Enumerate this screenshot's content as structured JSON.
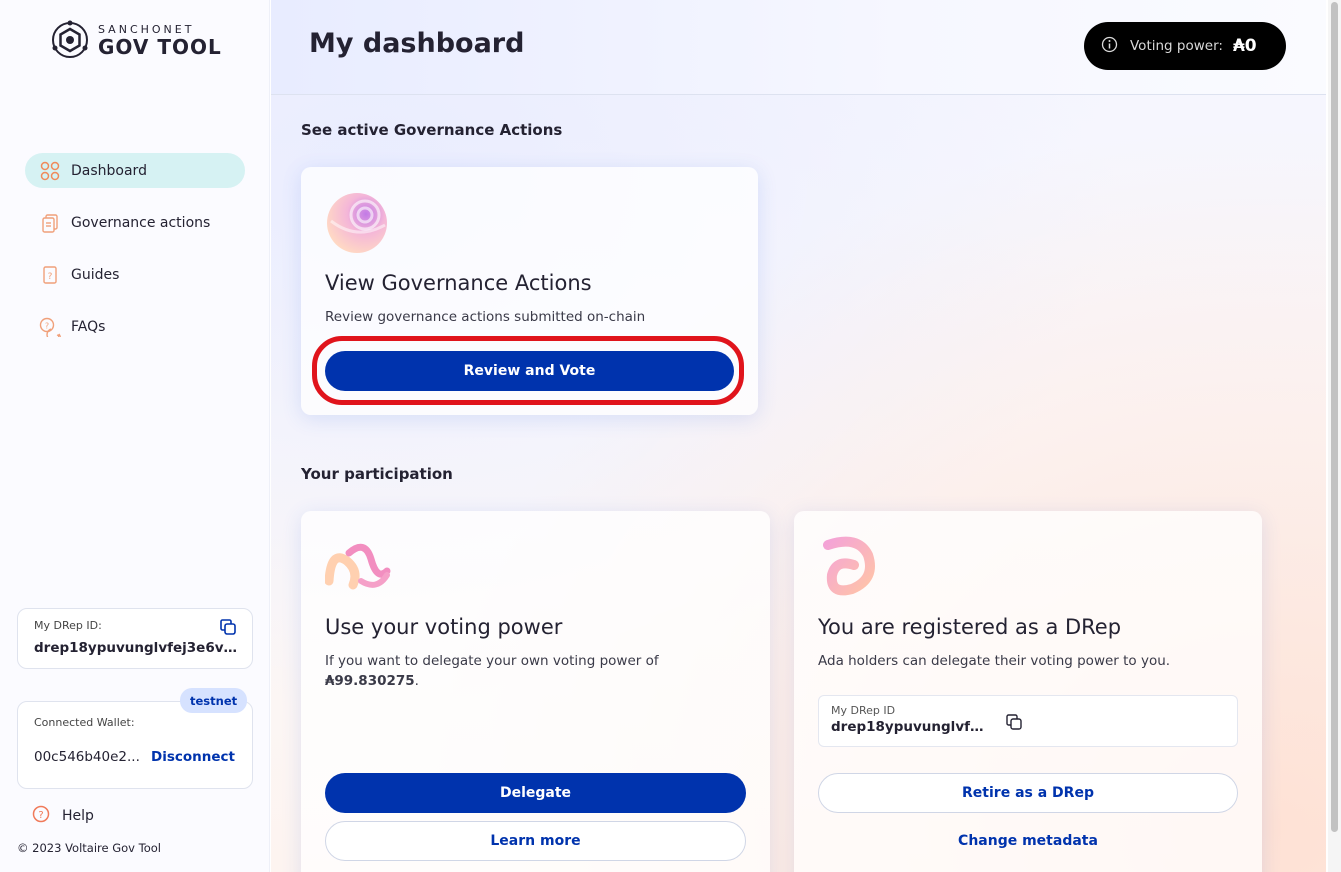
{
  "brand": {
    "top": "SANCHONET",
    "bottom": "GOV TOOL"
  },
  "sidebar": {
    "items": [
      {
        "label": "Dashboard",
        "icon": "dashboard-icon",
        "active": true
      },
      {
        "label": "Governance actions",
        "icon": "governance-actions-icon"
      },
      {
        "label": "Guides",
        "icon": "guides-icon"
      },
      {
        "label": "FAQs",
        "icon": "faqs-icon"
      }
    ],
    "drep": {
      "label": "My DRep ID:",
      "value": "drep18ypuvunglvfej3e6vw0..."
    },
    "wallet": {
      "label": "Connected Wallet:",
      "address": "00c546b40e2...",
      "disconnect": "Disconnect",
      "network": "testnet"
    },
    "help": "Help",
    "copyright": "© 2023 Voltaire Gov Tool"
  },
  "header": {
    "title": "My dashboard",
    "voting_power_label": "Voting power:",
    "voting_power_value": "₳0"
  },
  "sections": {
    "active": "See active Governance Actions",
    "participation": "Your participation"
  },
  "cards": {
    "view": {
      "title": "View Governance Actions",
      "description": "Review governance actions submitted on-chain",
      "button": "Review and Vote"
    },
    "voting": {
      "title": "Use your voting power",
      "description": "If you want to delegate your own voting power of",
      "amount": "₳99.830275",
      "amount_suffix": ".",
      "primary": "Delegate",
      "secondary": "Learn more"
    },
    "drep": {
      "title": "You are registered as a DRep",
      "description": "Ada holders can delegate their voting power to you.",
      "id_label": "My DRep ID",
      "id_value": "drep18ypuvunglvfej...",
      "primary": "Retire as a DRep",
      "secondary": "Change metadata"
    }
  },
  "colors": {
    "primary": "#0033ad",
    "highlight": "#e0141c",
    "active_nav": "#d6f2f3"
  }
}
